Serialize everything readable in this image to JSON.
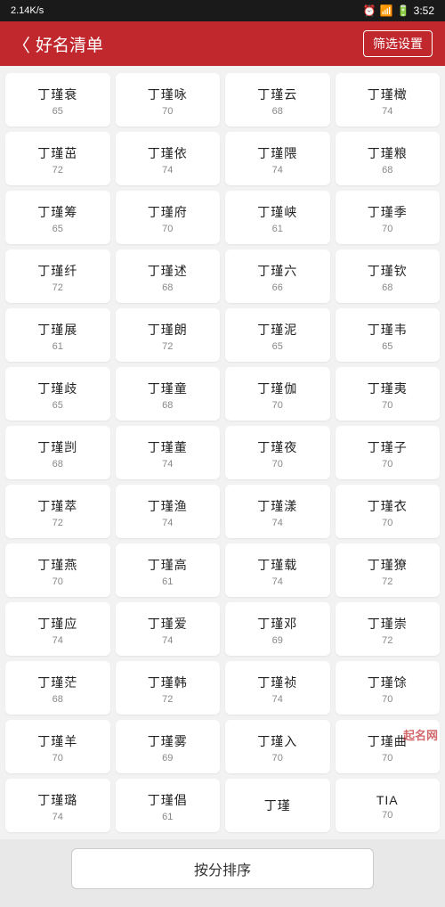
{
  "status_bar": {
    "speed": "2.14K/s",
    "time": "3:52"
  },
  "header": {
    "back_label": "〈",
    "title": "好名清单",
    "filter_label": "筛选设置"
  },
  "names": [
    {
      "text": "丁瑾衰",
      "score": "65"
    },
    {
      "text": "丁瑾咏",
      "score": "70"
    },
    {
      "text": "丁瑾云",
      "score": "68"
    },
    {
      "text": "丁瑾橄",
      "score": "74"
    },
    {
      "text": "丁瑾茁",
      "score": "72"
    },
    {
      "text": "丁瑾依",
      "score": "74"
    },
    {
      "text": "丁瑾隈",
      "score": "74"
    },
    {
      "text": "丁瑾粮",
      "score": "68"
    },
    {
      "text": "丁瑾筹",
      "score": "65"
    },
    {
      "text": "丁瑾府",
      "score": "70"
    },
    {
      "text": "丁瑾峡",
      "score": "61"
    },
    {
      "text": "丁瑾季",
      "score": "70"
    },
    {
      "text": "丁瑾纤",
      "score": "72"
    },
    {
      "text": "丁瑾述",
      "score": "68"
    },
    {
      "text": "丁瑾六",
      "score": "66"
    },
    {
      "text": "丁瑾钦",
      "score": "68"
    },
    {
      "text": "丁瑾展",
      "score": "61"
    },
    {
      "text": "丁瑾朗",
      "score": "72"
    },
    {
      "text": "丁瑾泥",
      "score": "65"
    },
    {
      "text": "丁瑾韦",
      "score": "65"
    },
    {
      "text": "丁瑾歧",
      "score": "65"
    },
    {
      "text": "丁瑾童",
      "score": "68"
    },
    {
      "text": "丁瑾伽",
      "score": "70"
    },
    {
      "text": "丁瑾夷",
      "score": "70"
    },
    {
      "text": "丁瑾剀",
      "score": "68"
    },
    {
      "text": "丁瑾董",
      "score": "74"
    },
    {
      "text": "丁瑾夜",
      "score": "70"
    },
    {
      "text": "丁瑾子",
      "score": "70"
    },
    {
      "text": "丁瑾萃",
      "score": "72"
    },
    {
      "text": "丁瑾渔",
      "score": "74"
    },
    {
      "text": "丁瑾漾",
      "score": "74"
    },
    {
      "text": "丁瑾衣",
      "score": "70"
    },
    {
      "text": "丁瑾燕",
      "score": "70"
    },
    {
      "text": "丁瑾高",
      "score": "61"
    },
    {
      "text": "丁瑾载",
      "score": "74"
    },
    {
      "text": "丁瑾獠",
      "score": "72"
    },
    {
      "text": "丁瑾应",
      "score": "74"
    },
    {
      "text": "丁瑾爱",
      "score": "74"
    },
    {
      "text": "丁瑾邓",
      "score": "69"
    },
    {
      "text": "丁瑾崇",
      "score": "72"
    },
    {
      "text": "丁瑾茫",
      "score": "68"
    },
    {
      "text": "丁瑾韩",
      "score": "72"
    },
    {
      "text": "丁瑾祯",
      "score": "74"
    },
    {
      "text": "丁瑾馀",
      "score": "70"
    },
    {
      "text": "丁瑾羊",
      "score": "70"
    },
    {
      "text": "丁瑾雾",
      "score": "69"
    },
    {
      "text": "丁瑾入",
      "score": "70"
    },
    {
      "text": "丁瑾曲",
      "score": "70"
    },
    {
      "text": "丁瑾璐",
      "score": "74"
    },
    {
      "text": "丁瑾倡",
      "score": "61"
    },
    {
      "text": "丁瑾",
      "score": ""
    },
    {
      "text": "TIA",
      "score": "70"
    }
  ],
  "sort_button_label": "按分排序",
  "watermark": "起名网"
}
